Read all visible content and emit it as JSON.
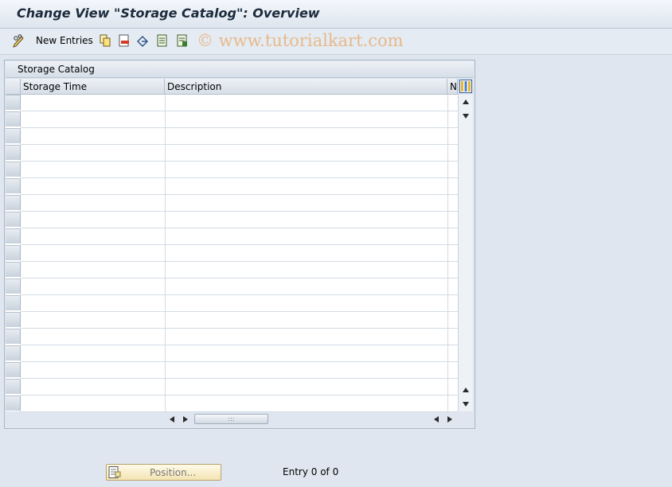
{
  "window": {
    "title": "Change View \"Storage Catalog\": Overview"
  },
  "toolbar": {
    "new_entries_label": "New Entries",
    "watermark": "© www.tutorialkart.com",
    "icons": [
      "pencil-glasses-icon",
      "copy-icon",
      "delete-icon",
      "undo-icon",
      "select-all-icon",
      "deselect-all-icon"
    ]
  },
  "panel": {
    "title": "Storage Catalog",
    "columns": [
      "Storage Time",
      "Description",
      "Nu"
    ],
    "row_count": 19
  },
  "footer": {
    "position_label": "Position...",
    "entry_info": "Entry 0 of 0"
  },
  "colors": {
    "background": "#dfe6ef",
    "title_text": "#1b2b3c",
    "button_yellow": "#f3e4b2",
    "watermark": "#e8b98a"
  }
}
